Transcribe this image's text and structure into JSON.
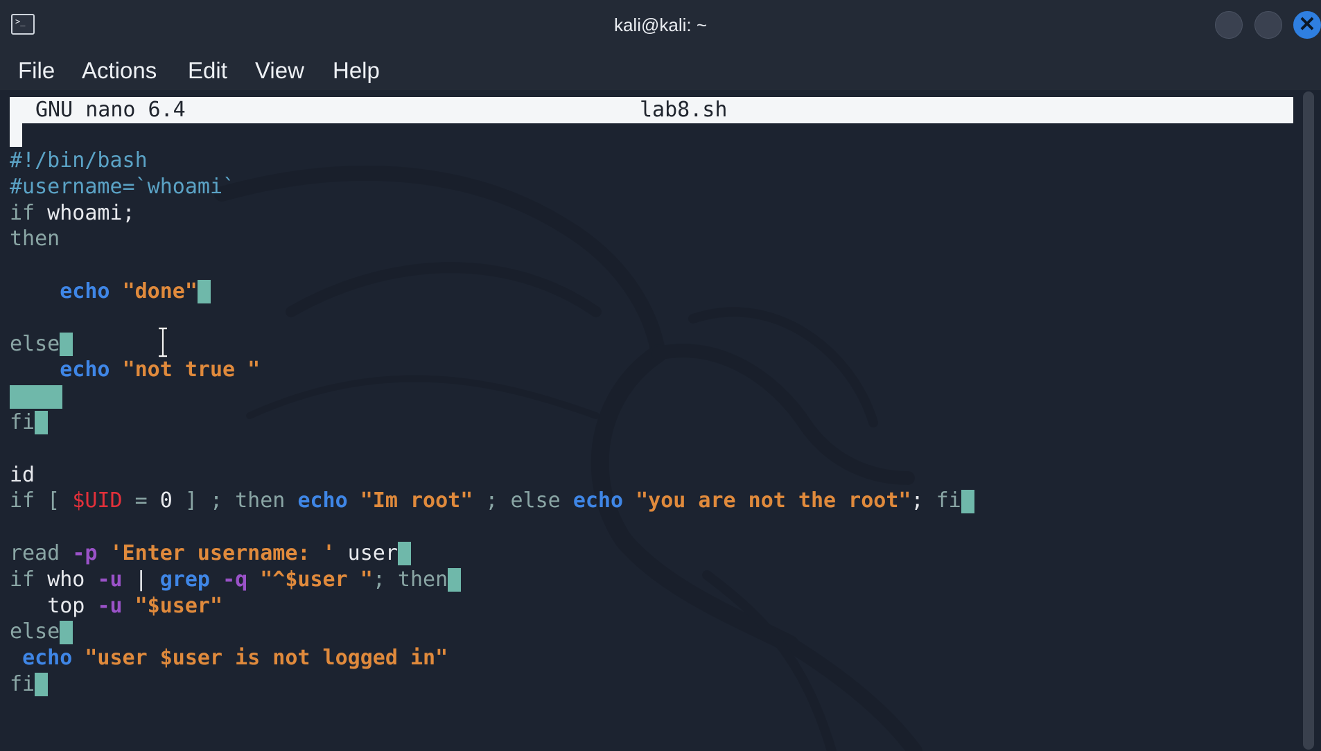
{
  "window": {
    "title": "kali@kali: ~",
    "app_icon_glyph": ">_",
    "close_glyph": "✕"
  },
  "menu": {
    "items": [
      "File",
      "Actions",
      "Edit",
      "View",
      "Help"
    ]
  },
  "nano": {
    "version": "GNU nano 6.4",
    "filename": "lab8.sh"
  },
  "code": {
    "l1": "#!/bin/bash",
    "l2": "#username=`whoami`",
    "l3_kw": "if",
    "l3_rest": " whoami;",
    "l4": "then",
    "l6_cmd": "echo",
    "l6_str": "\"done\"",
    "l8": "else",
    "l9_cmd": "echo",
    "l9_str": "\"not true \"",
    "l11": "fi",
    "l13": "id",
    "l14_if": "if [ ",
    "l14_var": "$UID",
    "l14_mid": " = ",
    "l14_zero": "0",
    "l14_then": " ] ; then ",
    "l14_echo1": "echo",
    "l14_str1": "\"Im root\"",
    "l14_else": " ; else ",
    "l14_echo2": "echo",
    "l14_str2": "\"you are not the root\"",
    "l14_semi": "; ",
    "l14_fi": "fi",
    "l16_read": "read ",
    "l16_opt": "-p",
    "l16_str": "'Enter username: '",
    "l16_user": " user",
    "l17_if": "if ",
    "l17_who": "who ",
    "l17_opt1": "-u",
    "l17_pipe": " | ",
    "l17_grep": "grep",
    "l17_opt2": "-q",
    "l17_str": "\"^$user \"",
    "l17_then": "; then",
    "l18_top": "top ",
    "l18_opt": "-u",
    "l18_str": "\"$user\"",
    "l19": "else",
    "l20_cmd": "echo",
    "l20_str": "\"user $user is not logged in\"",
    "l21": "fi"
  },
  "colors": {
    "background": "#1c2330",
    "comment": "#5ba3c6",
    "keyword": "#8aa6a5",
    "command": "#3f86e6",
    "string": "#e08a3c",
    "variable": "#e3303a",
    "option": "#9a52c8",
    "cursor": "#6fb8aa"
  }
}
